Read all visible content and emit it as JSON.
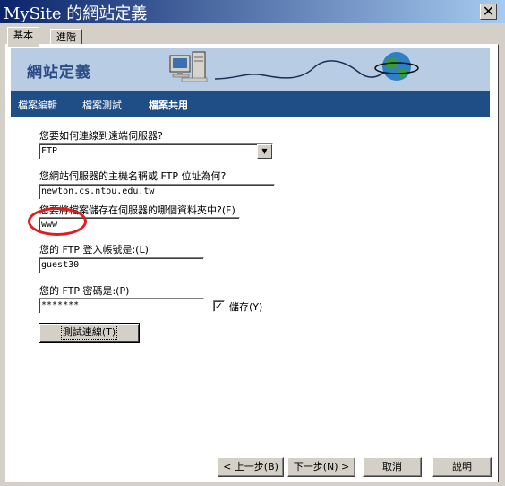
{
  "window": {
    "title": "MySite 的網站定義",
    "close_symbol": "✕"
  },
  "tabs": [
    {
      "label": "基本"
    },
    {
      "label": "進階"
    }
  ],
  "banner": {
    "title": "網站定義"
  },
  "nav": {
    "items": [
      {
        "label": "檔案編輯"
      },
      {
        "label": "檔案測試"
      },
      {
        "label": "檔案共用"
      }
    ]
  },
  "form": {
    "connect_label": "您要如何連線到遠端伺服器?",
    "connect_value": "FTP",
    "host_label": "您網站伺服器的主機名稱或 FTP 位址為何?",
    "host_value": "newton.cs.ntou.edu.tw",
    "folder_label": "您要將檔案儲存在伺服器的哪個資料夾中?(F)",
    "folder_value": "www",
    "login_label": "您的 FTP 登入帳號是:(L)",
    "login_value": "guest30",
    "password_label": "您的 FTP 密碼是:(P)",
    "password_value": "*******",
    "save_checkbox_label": "儲存(Y)",
    "save_checked": true,
    "test_button_label": "測試連線(T)"
  },
  "footer": {
    "back_label": "< 上一步(B)",
    "next_label": "下一步(N) >",
    "cancel_label": "取消",
    "help_label": "說明"
  },
  "icons": {
    "computer": "computer-icon",
    "globe": "globe-icon",
    "cable": "network-cable"
  },
  "colors": {
    "nav_bg": "#1f4d86",
    "banner_bg": "#b8cde4",
    "highlight_oval": "#e21c1c"
  }
}
